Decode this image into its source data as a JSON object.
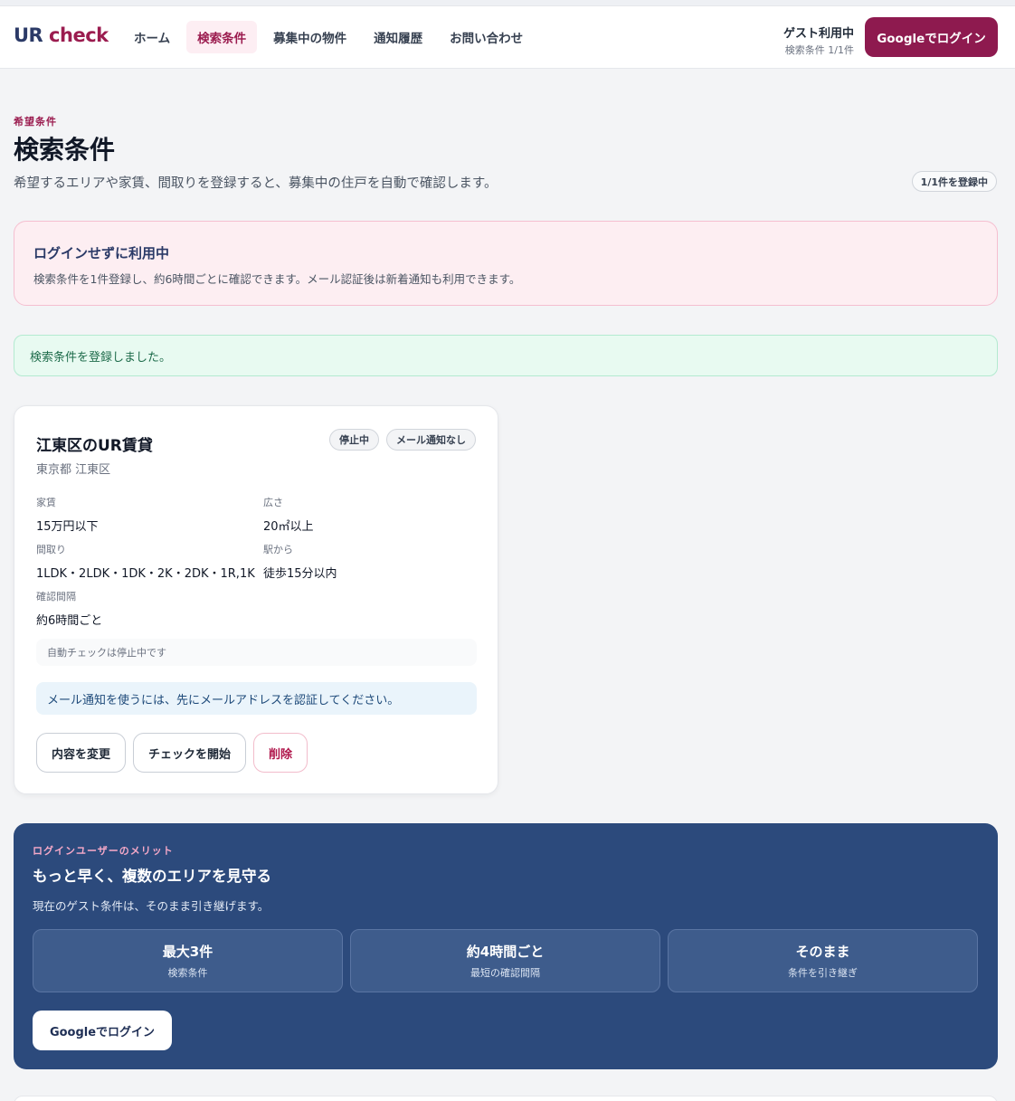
{
  "header": {
    "logo_main": "UR",
    "logo_accent": "check",
    "nav": [
      {
        "label": "ホーム"
      },
      {
        "label": "検索条件"
      },
      {
        "label": "募集中の物件"
      },
      {
        "label": "通知履歴"
      },
      {
        "label": "お問い合わせ"
      }
    ],
    "active_nav": "検索条件",
    "guest_title": "ゲスト利用中",
    "guest_sub": "検索条件 1/1件",
    "login_label": "Googleでログイン"
  },
  "page": {
    "eyebrow": "希望条件",
    "title": "検索条件",
    "description": "希望するエリアや家賃、間取りを登録すると、募集中の住戸を自動で確認します。",
    "count_badge": "1/1件を登録中"
  },
  "notice": {
    "title": "ログインせずに利用中",
    "body": "検索条件を1件登録し、約6時間ごとに確認できます。メール認証後は新着通知も利用できます。"
  },
  "success_message": "検索条件を登録しました。",
  "condition_card": {
    "title": "江東区のUR賃貸",
    "location": "東京都 江東区",
    "tags": [
      "停止中",
      "メール通知なし"
    ],
    "fields": {
      "rent": {
        "label": "家賃",
        "value": "15万円以下"
      },
      "area": {
        "label": "広さ",
        "value": "20㎡以上"
      },
      "layout": {
        "label": "間取り",
        "value": "1LDK・2LDK・1DK・2K・2DK・1R,1K"
      },
      "station": {
        "label": "駅から",
        "value": "徒歩15分以内"
      },
      "interval": {
        "label": "確認間隔",
        "value": "約6時間ごと"
      }
    },
    "status_text": "自動チェックは停止中です",
    "info_text": "メール通知を使うには、先にメールアドレスを認証してください。",
    "buttons": {
      "edit": "内容を変更",
      "start": "チェックを開始",
      "delete": "削除"
    }
  },
  "promo": {
    "eyebrow": "ログインユーザーのメリット",
    "title": "もっと早く、複数のエリアを見守る",
    "description": "現在のゲスト条件は、そのまま引き継げます。",
    "stats": [
      {
        "value": "最大3件",
        "label": "検索条件"
      },
      {
        "value": "約4時間ごと",
        "label": "最短の確認間隔"
      },
      {
        "value": "そのまま",
        "label": "条件を引き継ぎ"
      }
    ],
    "login_label": "Googleでログイン"
  },
  "colors": {
    "brand": "#8e1a4f",
    "navy": "#2c4a7c",
    "success_bg": "#e8faf1",
    "notice_bg": "#fdeef2"
  }
}
